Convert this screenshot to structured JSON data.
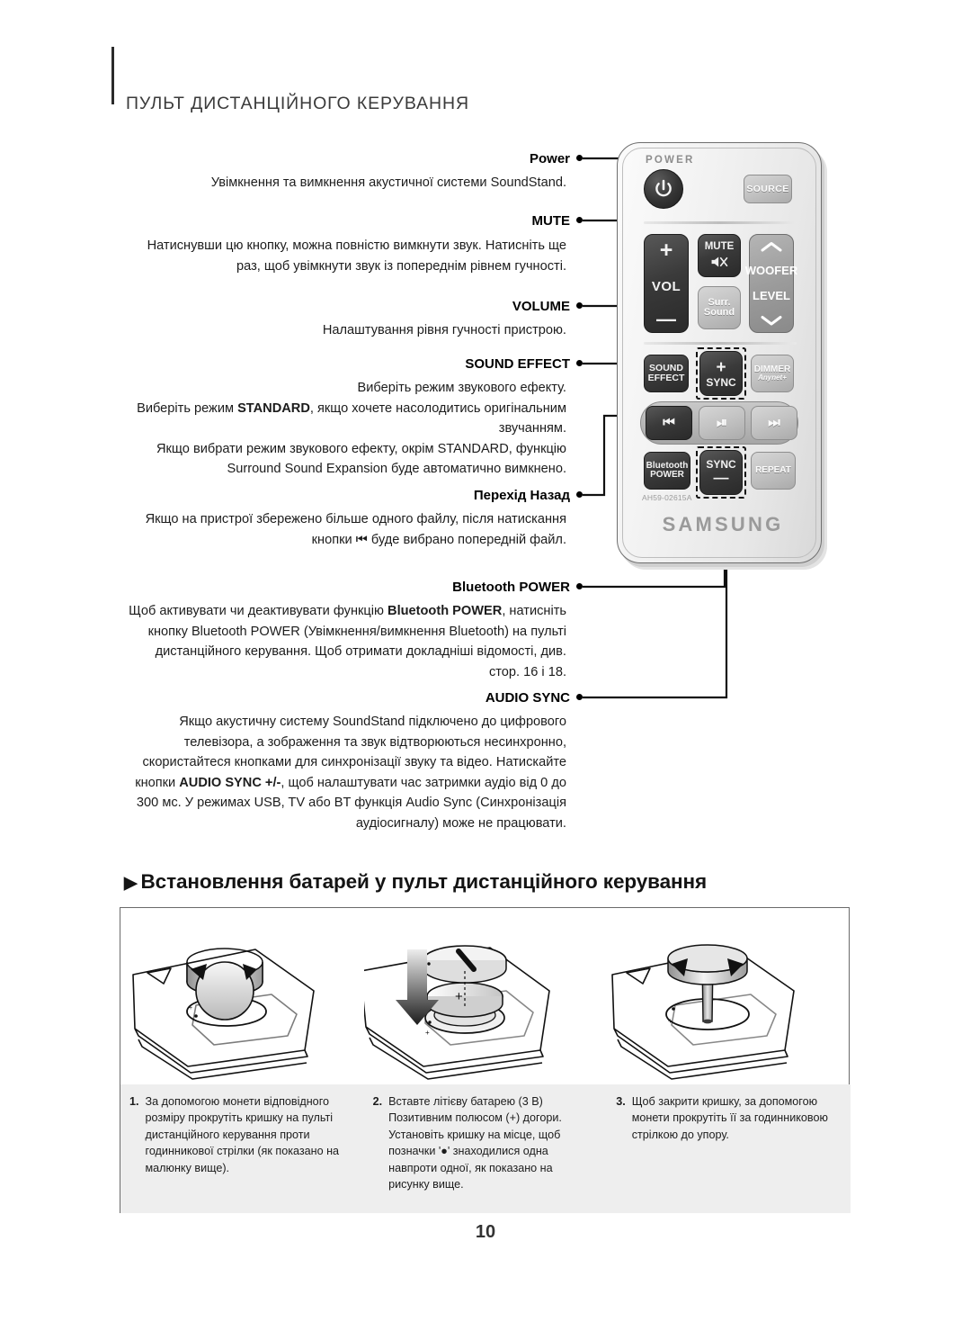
{
  "header": {
    "title": "ПУЛЬТ ДИСТАНЦІЙНОГО КЕРУВАННЯ"
  },
  "callouts": [
    {
      "label": "Power",
      "desc": "Увімкнення та вимкнення акустичної системи SoundStand."
    },
    {
      "label": "MUTE",
      "desc": "Натиснувши цю кнопку, можна повністю вимкнути звук. Натисніть ще раз, щоб увімкнути звук із попереднім рівнем гучності."
    },
    {
      "label": "VOLUME",
      "desc": "Налаштування рівня гучності пристрою."
    },
    {
      "label": "SOUND EFFECT",
      "desc_line1": "Виберіть режим звукового ефекту.",
      "desc_line2_a": "Виберіть режим ",
      "desc_line2_b": "STANDARD",
      "desc_line2_c": ", якщо хочете насолодитись оригінальним звучанням.",
      "desc_line3": "Якщо вибрати режим звукового ефекту, окрім STANDARD, функцію Surround Sound Expansion буде автоматично вимкнено."
    },
    {
      "label": "Перехід Назад",
      "desc_a": "Якщо на пристрої збережено більше одного файлу, після натискання кнопки ",
      "desc_icon": "⏮",
      "desc_b": " буде вибрано попередній файл."
    },
    {
      "label": "Bluetooth POWER",
      "desc_a": "Щоб активувати чи деактивувати функцію ",
      "desc_b": "Bluetooth POWER",
      "desc_c": ", натисніть кнопку Bluetooth POWER (Увімкнення/вимкнення Bluetooth) на пульті дистанційного керування. Щоб отримати докладніші відомості, див. стор. 16 і 18."
    },
    {
      "label": "AUDIO SYNC",
      "desc_a": "Якщо акустичну систему SoundStand підключено до цифрового телевізора, а зображення та звук відтворюються несинхронно, скористайтеся кнопками для синхронізації звуку та відео. Натискайте кнопки ",
      "desc_b": "AUDIO SYNC +/-",
      "desc_c": ", щоб налаштувати час затримки аудіо від 0 до 300 мс. У режимах USB, TV або BT функція Audio Sync (Синхронізація аудіосигналу) може не працювати."
    }
  ],
  "remote": {
    "power_label": "POWER",
    "power_icon": "power-icon",
    "source": "SOURCE",
    "vol_plus": "+",
    "vol_text": "VOL",
    "vol_minus": "—",
    "mute_text": "MUTE",
    "mute_icon": "mute-speaker-icon",
    "surr_line1": "Surr.",
    "surr_line2": "Sound",
    "woofer_up": "⌃",
    "woofer_line1": "WOOFER",
    "woofer_line2": "LEVEL",
    "woofer_down": "⌄",
    "se_line1": "SOUND",
    "se_line2": "EFFECT",
    "sync_plus_sym": "+",
    "sync_plus_text": "SYNC",
    "dimmer": "DIMMER",
    "dimmer_sub": "Anynet+",
    "prev_icon": "⏮",
    "play_icon": "⏯",
    "next_icon": "⏭",
    "bt_line1": "Bluetooth",
    "bt_line2": "POWER",
    "sync_minus_text": "SYNC",
    "sync_minus_sym": "—",
    "repeat": "REPEAT",
    "model_no": "AH59-02615A",
    "brand": "SAMSUNG"
  },
  "section": {
    "marker": "▶",
    "heading": "Встановлення батарей у пульт дистанційного керування"
  },
  "steps": [
    {
      "num": "1.",
      "text": "За допомогою монети відповідного розміру прокрутіть кришку на пульті дистанційного керування проти годинникової стрілки (як показано на малюнку вище)."
    },
    {
      "num": "2.",
      "text": "Вставте літієву батарею (3 В) Позитивним полюсом (+) догори. Установіть кришку на місце, щоб позначки '●' знаходилися одна навпроти одної, як показано на рисунку вище."
    },
    {
      "num": "3.",
      "text": "Щоб закрити кришку, за допомогою монети прокрутіть її за годинниковою стрілкою до упору."
    }
  ],
  "figures": [
    {
      "name": "remote-cover-unscrew-counterclockwise"
    },
    {
      "name": "battery-insert-positive-up"
    },
    {
      "name": "cover-screw-clockwise-with-coin"
    }
  ],
  "page_number": "10",
  "colors": {
    "accent": "#000000",
    "panel": "#eeeeee",
    "logo": "#9a9a9a"
  }
}
